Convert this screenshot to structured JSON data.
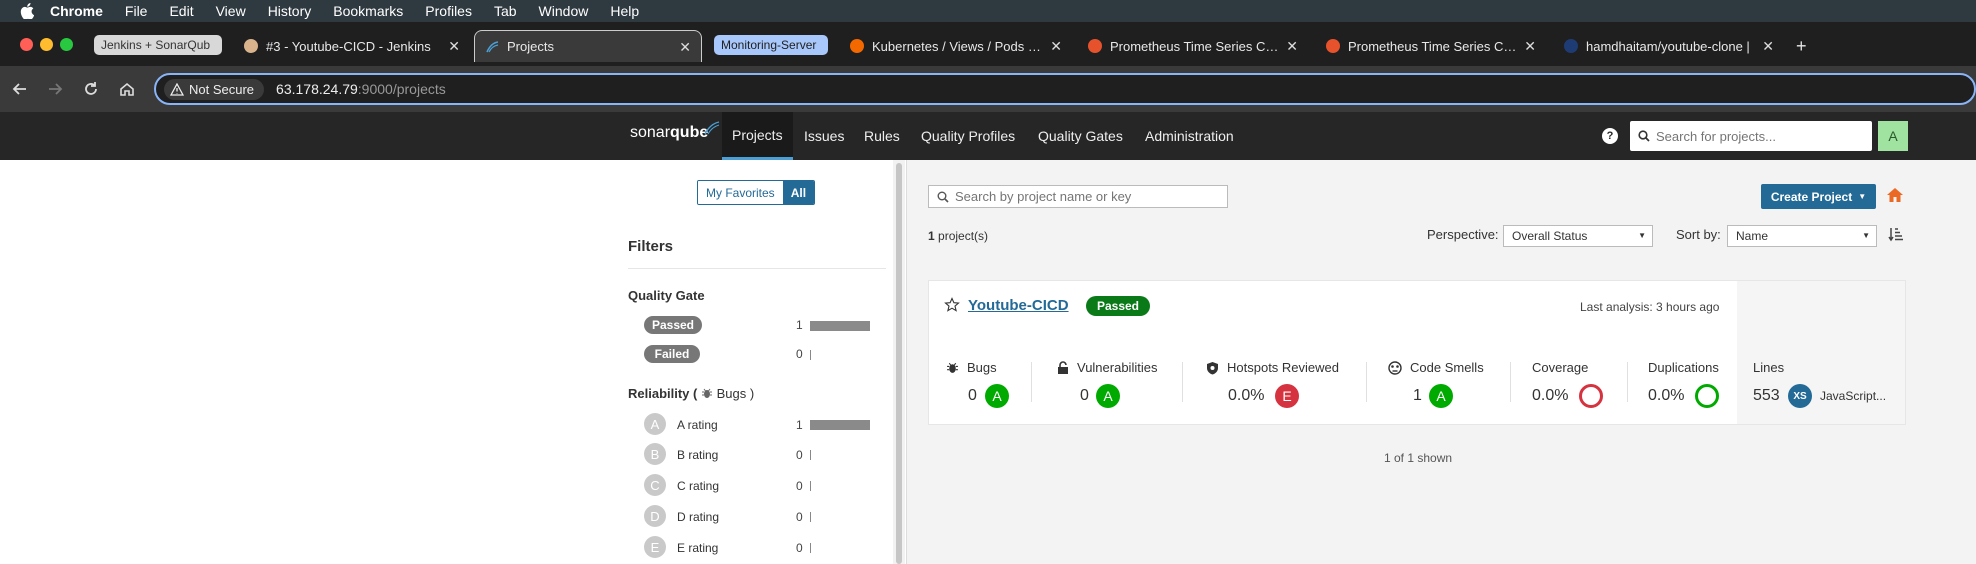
{
  "menubar": {
    "items": [
      "Chrome",
      "File",
      "Edit",
      "View",
      "History",
      "Bookmarks",
      "Profiles",
      "Tab",
      "Window",
      "Help"
    ]
  },
  "tabs": [
    {
      "label": "Jenkins + SonarQub",
      "kind": "pill"
    },
    {
      "label": "#3 - Youtube-CICD - Jenkins"
    },
    {
      "label": "Projects",
      "active": true
    },
    {
      "label": "Monitoring-Server",
      "kind": "pill-blue"
    },
    {
      "label": "Kubernetes / Views / Pods - D"
    },
    {
      "label": "Prometheus Time Series Colle"
    },
    {
      "label": "Prometheus Time Series Colle"
    },
    {
      "label": "hamdhaitam/youtube-clone |"
    }
  ],
  "toolbar": {
    "security": "Not Secure",
    "url_host": "63.178.24.79",
    "url_rest": ":9000/projects"
  },
  "sonar": {
    "logo_a": "sonar",
    "logo_b": "qube",
    "nav": [
      "Projects",
      "Issues",
      "Rules",
      "Quality Profiles",
      "Quality Gates",
      "Administration"
    ],
    "search_placeholder": "Search for projects...",
    "avatar": "A",
    "help": "?"
  },
  "sidebar": {
    "my_favorites": "My Favorites",
    "all": "All",
    "filters": "Filters",
    "quality_gate": {
      "title": "Quality Gate",
      "items": [
        {
          "label": "Passed",
          "count": "1",
          "fraction": 1
        },
        {
          "label": "Failed",
          "count": "0",
          "fraction": 0
        }
      ]
    },
    "reliability": {
      "title_a": "Reliability ( ",
      "title_b": "Bugs )",
      "items": [
        {
          "grade": "A",
          "label": "A rating",
          "count": "1",
          "fraction": 1
        },
        {
          "grade": "B",
          "label": "B rating",
          "count": "0",
          "fraction": 0
        },
        {
          "grade": "C",
          "label": "C rating",
          "count": "0",
          "fraction": 0
        },
        {
          "grade": "D",
          "label": "D rating",
          "count": "0",
          "fraction": 0
        },
        {
          "grade": "E",
          "label": "E rating",
          "count": "0",
          "fraction": 0
        }
      ]
    }
  },
  "main": {
    "search_placeholder": "Search by project name or key",
    "create_project": "Create Project",
    "project_count_num": "1",
    "project_count_text": " project(s)",
    "perspective_label": "Perspective:",
    "perspective_value": "Overall Status",
    "sort_label": "Sort by:",
    "sort_value": "Name",
    "shown": "1 of 1 shown"
  },
  "project": {
    "name": "Youtube-CICD",
    "gate": "Passed",
    "last_analysis": "Last analysis: 3 hours ago",
    "metrics": {
      "bugs": {
        "label": "Bugs",
        "value": "0",
        "grade": "A"
      },
      "vulnerabilities": {
        "label": "Vulnerabilities",
        "value": "0",
        "grade": "A"
      },
      "hotspots": {
        "label": "Hotspots Reviewed",
        "value": "0.0%",
        "grade": "E"
      },
      "code_smells": {
        "label": "Code Smells",
        "value": "1",
        "grade": "A"
      },
      "coverage": {
        "label": "Coverage",
        "value": "0.0%"
      },
      "duplications": {
        "label": "Duplications",
        "value": "0.0%"
      },
      "lines": {
        "label": "Lines",
        "value": "553",
        "size": "XS",
        "language": "JavaScript..."
      }
    }
  },
  "colors": {
    "accent": "#236a97",
    "passed": "#0a7a19",
    "grade_a": "#00aa00",
    "grade_e": "#d4333f"
  }
}
